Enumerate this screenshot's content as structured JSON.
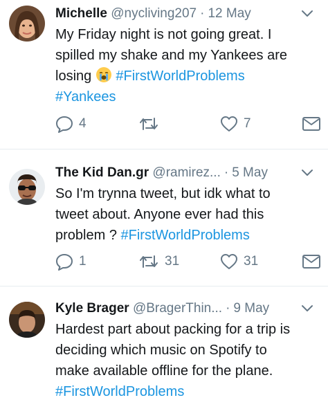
{
  "tweets": [
    {
      "name": "Michelle",
      "handle": "@nycliving207",
      "date": "12 May",
      "lines": [
        [
          {
            "t": "My Friday night is not going great.  I"
          }
        ],
        [
          {
            "t": "spilled my  shake and my Yankees are"
          }
        ],
        [
          {
            "t": "losing "
          },
          {
            "emoji": "crying-face-emoji"
          },
          {
            "t": " "
          },
          {
            "t": "#FirstWorldProblems",
            "tag": true
          }
        ],
        [
          {
            "t": "#Yankees",
            "tag": true
          }
        ]
      ],
      "reply_count": "4",
      "retweet_count": "",
      "like_count": "7"
    },
    {
      "name": "The Kid Dan.gr",
      "handle": "@ramirez...",
      "date": "5 May",
      "lines": [
        [
          {
            "t": "So I'm trynna tweet, but idk what to"
          }
        ],
        [
          {
            "t": "tweet about. Anyone ever had this"
          }
        ],
        [
          {
            "t": "problem ? "
          },
          {
            "t": "#FirstWorldProblems",
            "tag": true
          }
        ]
      ],
      "reply_count": "1",
      "retweet_count": "31",
      "like_count": "31"
    },
    {
      "name": "Kyle Brager",
      "handle": "@BragerThin...",
      "date": "9 May",
      "lines": [
        [
          {
            "t": "Hardest part about packing for a trip is"
          }
        ],
        [
          {
            "t": "deciding which music on Spotify to"
          }
        ],
        [
          {
            "t": "make available offline for the plane."
          }
        ],
        [
          {
            "t": "#FirstWorldProblems",
            "tag": true
          }
        ]
      ]
    }
  ],
  "separator": "·",
  "icons": {
    "chevron": "chevron-down-icon",
    "reply": "reply-icon",
    "retweet": "retweet-icon",
    "like": "heart-icon",
    "message": "envelope-icon"
  },
  "colors": {
    "hashtag": "#1b95e0",
    "muted": "#657786",
    "divider": "#e6ecf0",
    "text": "#14171a"
  }
}
